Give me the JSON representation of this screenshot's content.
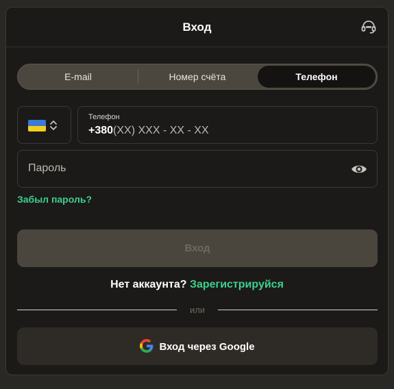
{
  "header": {
    "title": "Вход",
    "support_icon": "headset-icon"
  },
  "tabs": [
    {
      "label": "E-mail",
      "active": false
    },
    {
      "label": "Номер счёта",
      "active": false
    },
    {
      "label": "Телефон",
      "active": true
    }
  ],
  "country_selector": {
    "flag": "ukraine-flag-icon",
    "chevron": "chevron-updown-icon"
  },
  "phone_field": {
    "label": "Телефон",
    "code": "+380",
    "mask": "(XX) XXX - XX - XX"
  },
  "password_field": {
    "placeholder": "Пароль",
    "toggle_icon": "eye-icon"
  },
  "forgot_link": "Забыл пароль?",
  "login_button": "Вход",
  "register": {
    "question": "Нет аккаунта?",
    "link": "Зарегистрируйся"
  },
  "divider_text": "или",
  "google_button": {
    "label": "Вход через Google",
    "icon": "google-icon"
  },
  "colors": {
    "accent": "#3ecf8e",
    "background": "#1b1a18",
    "button_disabled": "#4a463e"
  }
}
